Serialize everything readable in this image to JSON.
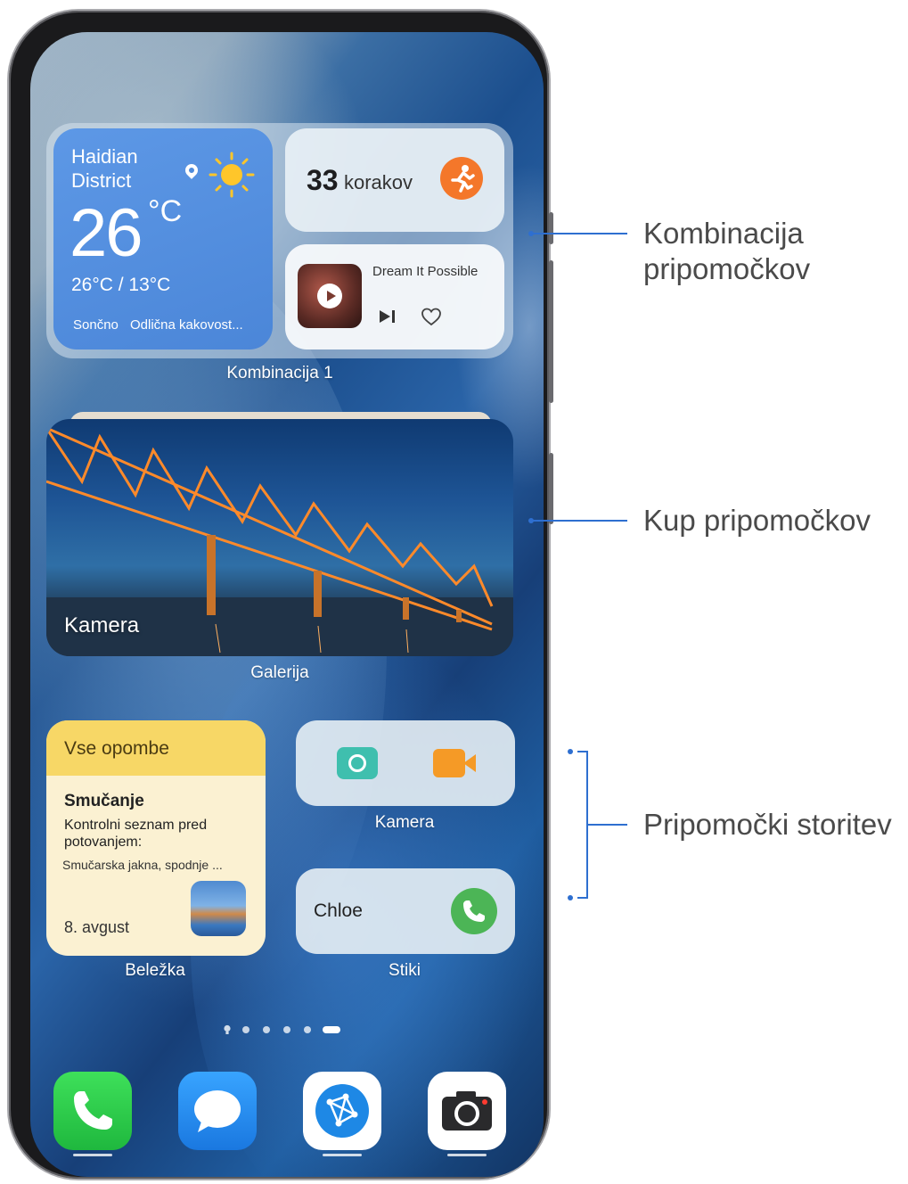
{
  "combination": {
    "weather": {
      "city": "Haidian District",
      "temp": "26",
      "unit": "°C",
      "range": "26°C / 13°C",
      "condition": "Sončno",
      "air": "Odlična kakovost..."
    },
    "steps": {
      "count": "33",
      "label": "korakov"
    },
    "music": {
      "title": "Dream It Possible"
    },
    "label": "Kombinacija 1"
  },
  "gallery": {
    "caption": "Kamera",
    "label": "Galerija"
  },
  "notes": {
    "header": "Vse opombe",
    "title": "Smučanje",
    "body": "Kontrolni seznam pred potovanjem:",
    "items": "Smučarska jakna, spodnje ...",
    "date": "8. avgust",
    "label": "Beležka"
  },
  "camera_widget": {
    "label": "Kamera"
  },
  "contact": {
    "name": "Chloe",
    "label": "Stiki"
  },
  "page_indicator": {
    "count": 6,
    "active": 6
  },
  "dock": [
    {
      "name": "phone-app",
      "color": "#2ec94a"
    },
    {
      "name": "messages-app",
      "color": "#2f8ff0"
    },
    {
      "name": "browser-app",
      "color": "#ffffff"
    },
    {
      "name": "camera-app",
      "color": "#ffffff"
    }
  ],
  "callouts": {
    "combination": "Kombinacija pripomočkov",
    "stack": "Kup pripomočkov",
    "service": "Pripomočki storitev"
  },
  "colors": {
    "callout": "#2e6fd0",
    "weather_bg": "#4b86d8",
    "notes_header": "#f7d766",
    "steps_icon": "#f4772a",
    "call_button": "#4cb556"
  }
}
